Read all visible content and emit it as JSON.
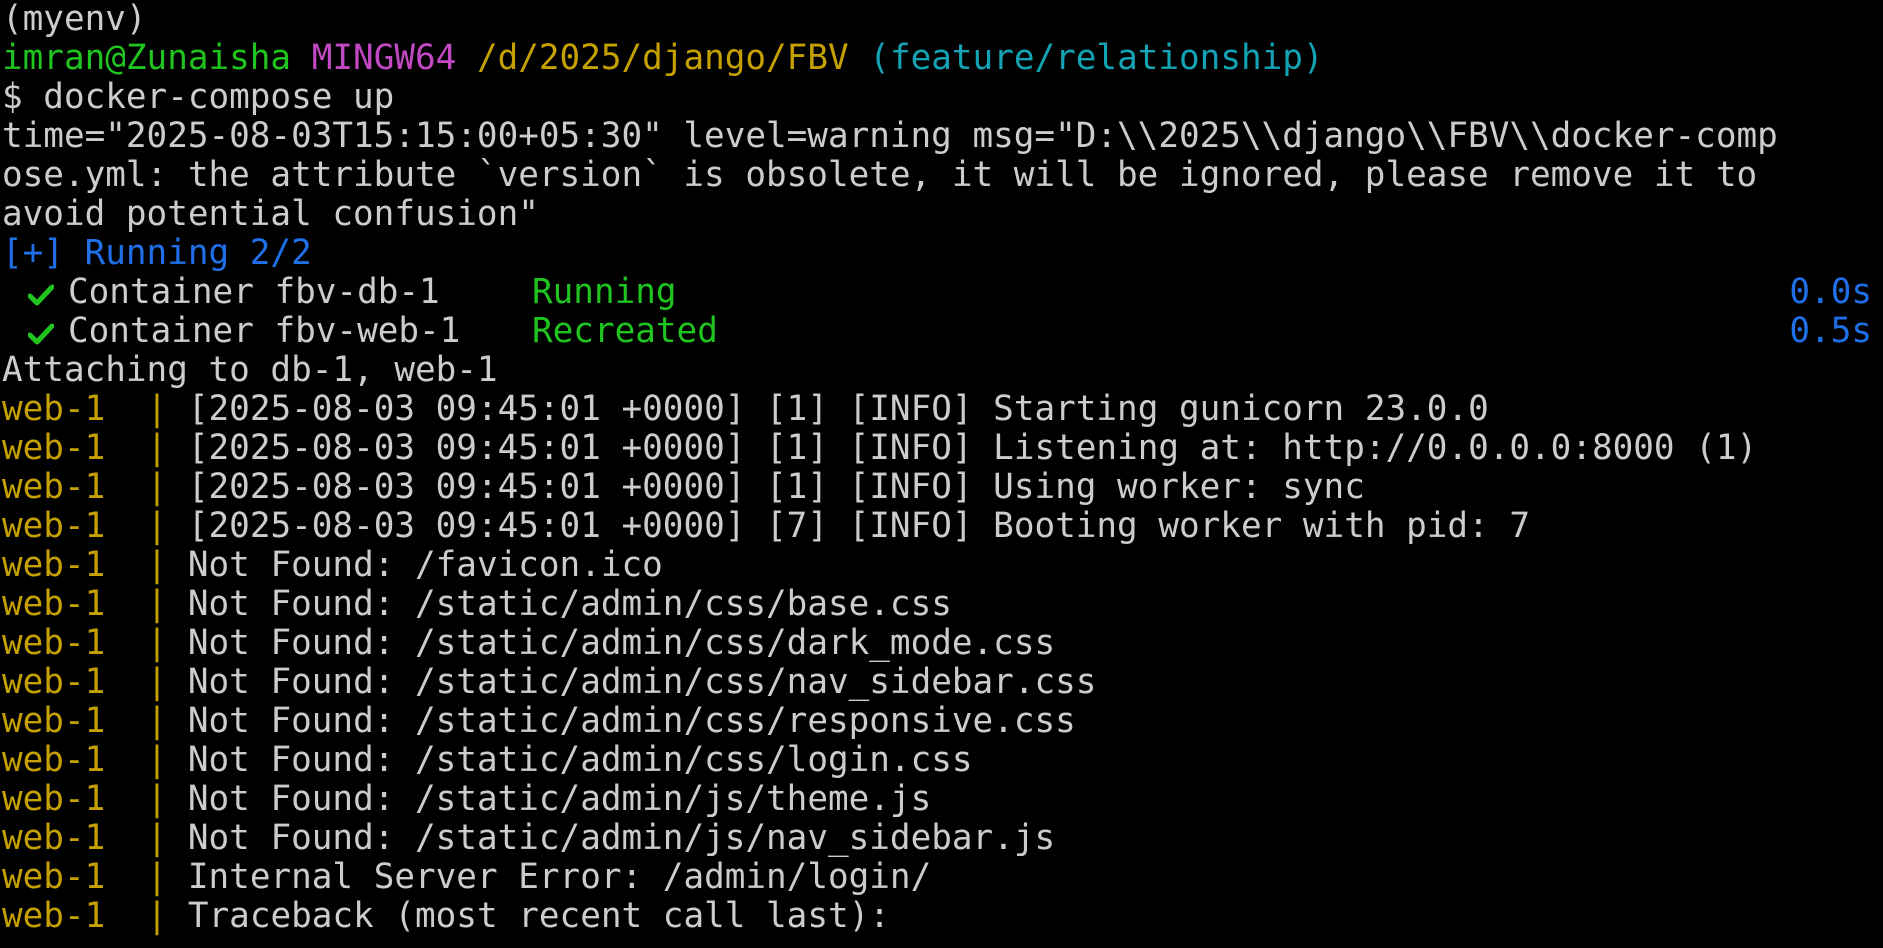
{
  "terminal": {
    "venv_line": "(myenv)",
    "prompt": {
      "user_host": "imran@Zunaisha",
      "system": "MINGW64",
      "path": "/d/2025/django/FBV",
      "branch": "(feature/relationship)"
    },
    "command": "$ docker-compose up",
    "warning_lines": [
      "time=\"2025-08-03T15:15:00+05:30\" level=warning msg=\"D:\\\\2025\\\\django\\\\FBV\\\\docker-comp",
      "ose.yml: the attribute `version` is obsolete, it will be ignored, please remove it to",
      "avoid potential confusion\""
    ],
    "running_status": "[+] Running 2/2",
    "containers": [
      {
        "name": "Container fbv-db-1",
        "status": "Running",
        "time": "0.0s"
      },
      {
        "name": "Container fbv-web-1",
        "status": "Recreated",
        "time": "0.5s"
      }
    ],
    "attaching": "Attaching to db-1, web-1",
    "log_prefix": "web-1",
    "log_separator": "|",
    "log_lines": [
      "[2025-08-03 09:45:01 +0000] [1] [INFO] Starting gunicorn 23.0.0",
      "[2025-08-03 09:45:01 +0000] [1] [INFO] Listening at: http://0.0.0.0:8000 (1)",
      "[2025-08-03 09:45:01 +0000] [1] [INFO] Using worker: sync",
      "[2025-08-03 09:45:01 +0000] [7] [INFO] Booting worker with pid: 7",
      "Not Found: /favicon.ico",
      "Not Found: /static/admin/css/base.css",
      "Not Found: /static/admin/css/dark_mode.css",
      "Not Found: /static/admin/css/nav_sidebar.css",
      "Not Found: /static/admin/css/responsive.css",
      "Not Found: /static/admin/css/login.css",
      "Not Found: /static/admin/js/theme.js",
      "Not Found: /static/admin/js/nav_sidebar.js",
      "Internal Server Error: /admin/login/",
      "Traceback (most recent call last):"
    ],
    "colors": {
      "background": "#000000",
      "text": "#cccccc",
      "green": "#1fc41f",
      "magenta": "#c348c3",
      "yellow": "#c4a000",
      "cyan": "#13a3b5",
      "blue": "#1f6fe8"
    }
  }
}
